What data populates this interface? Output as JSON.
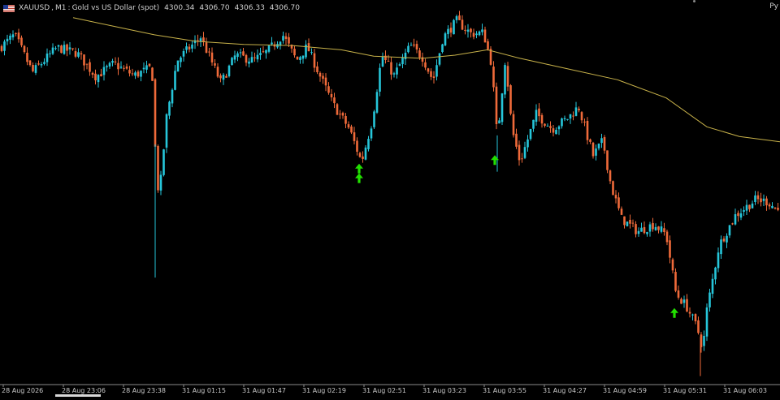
{
  "header": {
    "symbol": "XAUUSD",
    "timeframe": "M1",
    "description": "Gold vs US Dollar (spot)",
    "prices": [
      "4300.34",
      "4306.70",
      "4306.33",
      "4306.70"
    ],
    "corner_label": "Py"
  },
  "colors": {
    "background": "#000000",
    "bull": "#26c6da",
    "bear": "#ef6a3a",
    "ma": "#c8b24a",
    "arrow": "#22e000",
    "axis": "#8a8a8a",
    "text": "#c8c8c8"
  },
  "chart_data": {
    "type": "candlestick",
    "x_ticks": [
      "28 Aug 2026",
      "28 Aug 23:06",
      "28 Aug 23:38",
      "31 Aug 01:15",
      "31 Aug 01:47",
      "31 Aug 02:19",
      "31 Aug 02:51",
      "31 Aug 03:23",
      "31 Aug 03:55",
      "31 Aug 04:27",
      "31 Aug 04:59",
      "31 Aug 05:31",
      "31 Aug 06:03"
    ],
    "close_series": [
      [
        0,
        4304.5
      ],
      [
        18,
        4305.7
      ],
      [
        40,
        4302.2
      ],
      [
        70,
        4304.5
      ],
      [
        95,
        4304.0
      ],
      [
        118,
        4301.8
      ],
      [
        140,
        4303.0
      ],
      [
        165,
        4301.9
      ],
      [
        185,
        4302.6
      ],
      [
        188,
        4301.6
      ],
      [
        192,
        4293.0
      ],
      [
        196,
        4290.5
      ],
      [
        205,
        4298.0
      ],
      [
        218,
        4303.3
      ],
      [
        232,
        4304.4
      ],
      [
        247,
        4305.5
      ],
      [
        258,
        4303.6
      ],
      [
        272,
        4301.2
      ],
      [
        290,
        4303.8
      ],
      [
        312,
        4303.3
      ],
      [
        330,
        4304.2
      ],
      [
        348,
        4305.7
      ],
      [
        365,
        4303.3
      ],
      [
        378,
        4304.6
      ],
      [
        393,
        4302.0
      ],
      [
        410,
        4299.2
      ],
      [
        430,
        4296.9
      ],
      [
        445,
        4293.8
      ],
      [
        458,
        4297.6
      ],
      [
        470,
        4303.8
      ],
      [
        485,
        4301.9
      ],
      [
        505,
        4304.7
      ],
      [
        520,
        4303.6
      ],
      [
        533,
        4301.4
      ],
      [
        545,
        4305.4
      ],
      [
        562,
        4307.0
      ],
      [
        580,
        4305.8
      ],
      [
        595,
        4305.9
      ],
      [
        605,
        4303.0
      ],
      [
        612,
        4296.0
      ],
      [
        622,
        4303.6
      ],
      [
        630,
        4296.9
      ],
      [
        640,
        4293.8
      ],
      [
        660,
        4298.3
      ],
      [
        680,
        4296.9
      ],
      [
        700,
        4298.0
      ],
      [
        712,
        4299.0
      ],
      [
        730,
        4294.4
      ],
      [
        742,
        4295.8
      ],
      [
        752,
        4291.6
      ],
      [
        765,
        4288.5
      ],
      [
        785,
        4287.3
      ],
      [
        805,
        4288.0
      ],
      [
        820,
        4287.0
      ],
      [
        832,
        4281.5
      ],
      [
        845,
        4280.3
      ],
      [
        858,
        4278.3
      ],
      [
        865,
        4276.3
      ],
      [
        870,
        4280.0
      ],
      [
        885,
        4286.0
      ],
      [
        905,
        4288.8
      ],
      [
        930,
        4290.3
      ],
      [
        945,
        4290.1
      ],
      [
        960,
        4289.1
      ]
    ],
    "spikes": [
      {
        "x": 191,
        "low": 4283.0
      },
      {
        "x": 612,
        "low": 4292.9
      },
      {
        "x": 862,
        "low": 4273.8
      }
    ],
    "moving_average": [
      [
        90,
        4307.3
      ],
      [
        140,
        4306.5
      ],
      [
        190,
        4305.7
      ],
      [
        240,
        4305.1
      ],
      [
        300,
        4304.8
      ],
      [
        360,
        4304.7
      ],
      [
        420,
        4304.3
      ],
      [
        460,
        4303.7
      ],
      [
        520,
        4303.5
      ],
      [
        560,
        4303.8
      ],
      [
        600,
        4304.3
      ],
      [
        640,
        4303.5
      ],
      [
        700,
        4302.5
      ],
      [
        760,
        4301.5
      ],
      [
        820,
        4299.8
      ],
      [
        870,
        4297.1
      ],
      [
        910,
        4296.2
      ],
      [
        960,
        4295.7
      ]
    ],
    "buy_arrows": [
      {
        "x": 442,
        "price": 4293.8
      },
      {
        "x": 442,
        "price": 4292.9
      },
      {
        "x": 609,
        "price": 4294.6
      },
      {
        "x": 830,
        "price": 4280.3
      }
    ],
    "ylim": [
      4273.0,
      4308.5
    ],
    "xlim": [
      0,
      960
    ],
    "grid": false
  }
}
